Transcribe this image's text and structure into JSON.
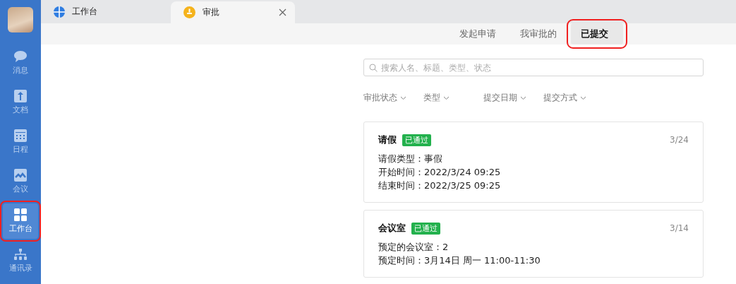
{
  "sidebar": {
    "items": [
      {
        "label": "消息",
        "kind": "chat",
        "selected": false,
        "highlighted": false
      },
      {
        "label": "文档",
        "kind": "doc",
        "selected": false,
        "highlighted": false
      },
      {
        "label": "日程",
        "kind": "calendar",
        "selected": false,
        "highlighted": false
      },
      {
        "label": "会议",
        "kind": "meeting",
        "selected": false,
        "highlighted": false
      },
      {
        "label": "工作台",
        "kind": "grid",
        "selected": true,
        "highlighted": true
      },
      {
        "label": "通讯录",
        "kind": "org",
        "selected": false,
        "highlighted": false
      }
    ]
  },
  "tabs": [
    {
      "label": "工作台",
      "kind": "workbench",
      "selected": false,
      "closable": false
    },
    {
      "label": "审批",
      "kind": "approval",
      "selected": true,
      "closable": true
    }
  ],
  "segments": [
    {
      "label": "发起申请",
      "selected": false,
      "highlighted": false
    },
    {
      "label": "我审批的",
      "selected": false,
      "highlighted": false
    },
    {
      "label": "已提交",
      "selected": true,
      "highlighted": true
    }
  ],
  "search": {
    "placeholder": "搜索人名、标题、类型、状态"
  },
  "filters": [
    "审批状态",
    "类型",
    "提交日期",
    "提交方式"
  ],
  "cards": [
    {
      "title": "请假",
      "status": "已通过",
      "date": "3/24",
      "lines": [
        "请假类型：事假",
        "开始时间：2022/3/24 09:25",
        "结束时间：2022/3/25 09:25"
      ]
    },
    {
      "title": "会议室",
      "status": "已通过",
      "date": "3/14",
      "lines": [
        "预定的会议室：2",
        "预定时间：3月14日 周一 11:00-11:30"
      ]
    }
  ]
}
